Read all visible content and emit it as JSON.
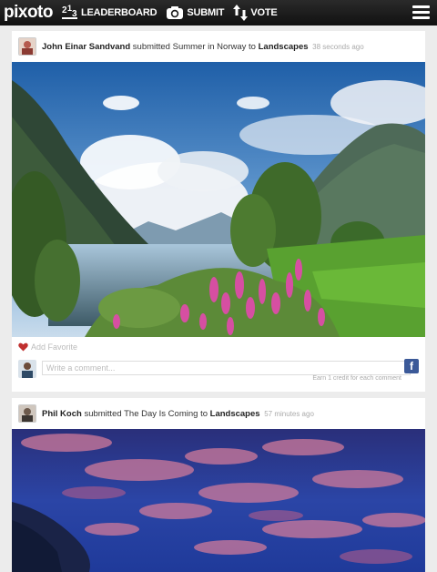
{
  "header": {
    "logo": "pixoto",
    "nav": [
      {
        "label": "Leaderboard",
        "icon": "leaderboard-icon"
      },
      {
        "label": "Submit",
        "icon": "camera-icon"
      },
      {
        "label": "Vote",
        "icon": "vote-arrows-icon"
      }
    ],
    "menu_icon": "hamburger-menu-icon"
  },
  "feed": [
    {
      "user": "John Einar Sandvand",
      "action": "submitted",
      "photo_title": "Summer in Norway",
      "connector": "to",
      "category": "Landscapes",
      "time": "38 seconds ago",
      "favorite_label": "Add Favorite",
      "comment_placeholder": "Write a comment...",
      "credit_note": "Earn 1 credit for each comment"
    },
    {
      "user": "Phil Koch",
      "action": "submitted",
      "photo_title": "The Day Is Coming",
      "connector": "to",
      "category": "Landscapes",
      "time": "57 minutes ago"
    }
  ],
  "colors": {
    "topbar": "#1a1a1a",
    "favorite_heart": "#c0302f",
    "facebook": "#3b5998"
  }
}
